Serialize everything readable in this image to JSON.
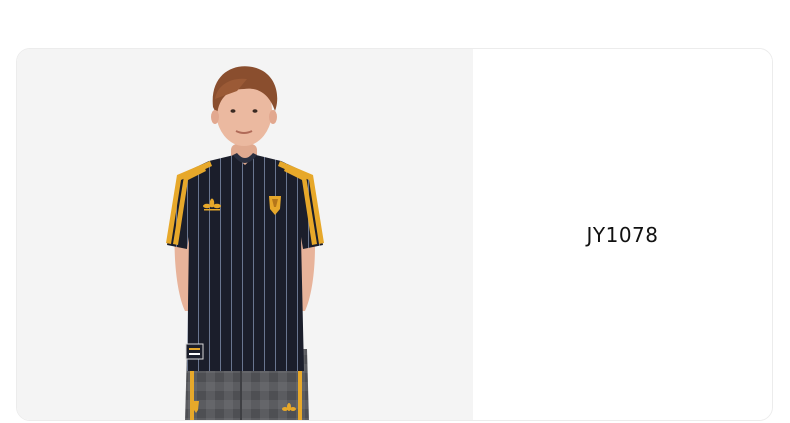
{
  "product": {
    "sku": "JY1078",
    "image_icon": "product-photo-jersey",
    "colors": {
      "jersey": "#1b1e2b",
      "stripe_gold": "#e7a82a",
      "pinstripe": "#6a7690",
      "trousers": "#58595c",
      "skin": "#e8b39a",
      "hair": "#8a4e2e",
      "image_background": "#f4f4f4"
    }
  }
}
